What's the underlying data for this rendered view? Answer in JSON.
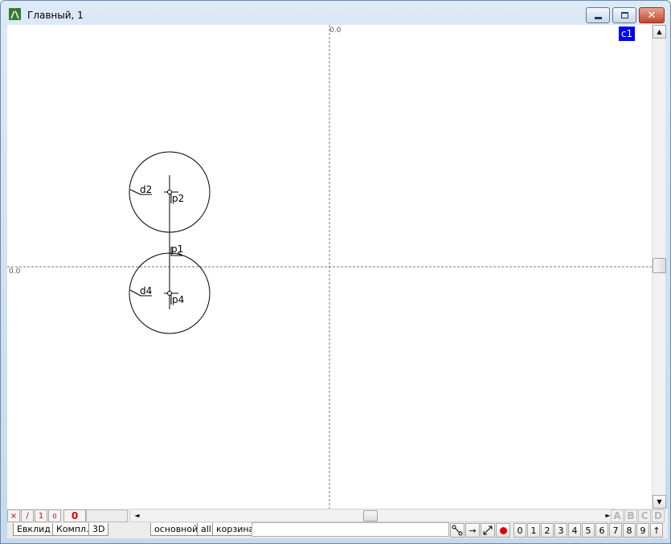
{
  "window": {
    "title": "Главный, 1",
    "controls": {
      "minimize": "minimize-icon",
      "maximize": "maximize-icon",
      "close": "✕"
    }
  },
  "canvas": {
    "origin_x_label": "0.0",
    "origin_y_label": "0.0",
    "layer_badge": "c1",
    "labels": {
      "d2": "d2",
      "p2": "p2",
      "p1": "p1",
      "d4": "d4",
      "p4": "p4"
    }
  },
  "status": {
    "mini_buttons": [
      "×",
      "∕",
      "1",
      "0"
    ],
    "counter": "0",
    "letters": [
      "A",
      "B",
      "C",
      "D"
    ]
  },
  "tabs": {
    "mode_tabs": [
      "Евклид",
      "Компл.",
      "3D"
    ],
    "layer_tabs": [
      "основной",
      "all",
      "корзина"
    ]
  },
  "toolbar": {
    "tools": [
      "snap-node-icon",
      "arrow-right-icon",
      "diagonal-arrow-icon",
      "record-icon"
    ],
    "record_color": "#e00000",
    "numbers": [
      "0",
      "1",
      "2",
      "3",
      "4",
      "5",
      "6",
      "7",
      "8",
      "9",
      "↑"
    ]
  },
  "colors": {
    "badge_bg": "#0000ff",
    "counter_red": "#e00000"
  }
}
